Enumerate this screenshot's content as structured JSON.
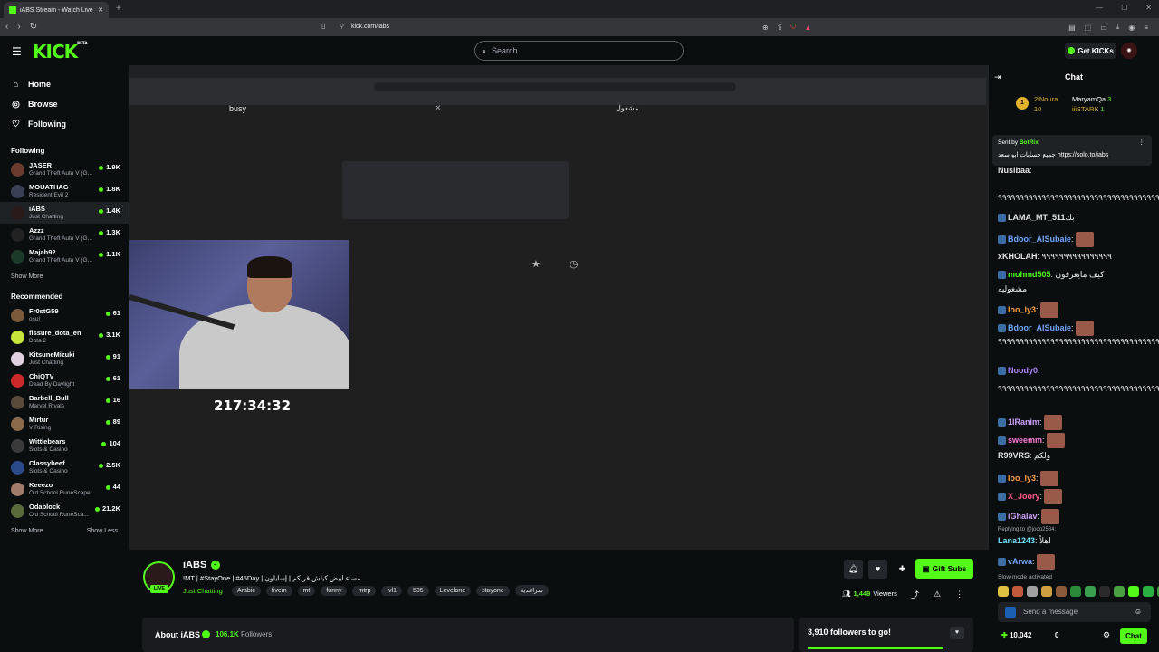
{
  "browser": {
    "tab_title": "iABS Stream - Watch Live on Kick",
    "new_tab": "+",
    "url": "kick.com/iabs"
  },
  "topnav": {
    "logo": "KICK",
    "logo_sup": "BETA",
    "search_placeholder": "Search",
    "get_kicks": "Get KICKs"
  },
  "sidebar": {
    "nav": [
      {
        "label": "Home",
        "icon": "home-icon"
      },
      {
        "label": "Browse",
        "icon": "compass-icon"
      },
      {
        "label": "Following",
        "icon": "heart-icon"
      }
    ],
    "following_title": "Following",
    "following": [
      {
        "name": "JASER",
        "category": "Grand Theft Auto V (G...",
        "viewers": "1.9K",
        "color": "#6b3b2f"
      },
      {
        "name": "MOUATHAG",
        "category": "Resident Evil 2",
        "viewers": "1.8K",
        "color": "#3a3f55"
      },
      {
        "name": "iABS",
        "category": "Just Chatting",
        "viewers": "1.4K",
        "color": "#2a1a1a"
      },
      {
        "name": "Azzz",
        "category": "Grand Theft Auto V (G...",
        "viewers": "1.3K",
        "color": "#222"
      },
      {
        "name": "Majah92",
        "category": "Grand Theft Auto V (G...",
        "viewers": "1.1K",
        "color": "#1b3a2a"
      }
    ],
    "show_more_1": "Show More",
    "recommended_title": "Recommended",
    "recommended": [
      {
        "name": "Fr0stG59",
        "category": "osu!",
        "viewers": "61",
        "color": "#7a5a3a"
      },
      {
        "name": "fissure_dota_en",
        "category": "Dota 2",
        "viewers": "3.1K",
        "color": "#c8e63a"
      },
      {
        "name": "KitsuneMizuki",
        "category": "Just Chatting",
        "viewers": "91",
        "color": "#e0d0e0"
      },
      {
        "name": "ChiQTV",
        "category": "Dead By Daylight",
        "viewers": "61",
        "color": "#cc2a2a"
      },
      {
        "name": "Barbell_Bull",
        "category": "Marvel Rivals",
        "viewers": "16",
        "color": "#5a4a3a"
      },
      {
        "name": "Mirtur",
        "category": "V Rising",
        "viewers": "89",
        "color": "#8a6a4a"
      },
      {
        "name": "Wittlebears",
        "category": "Slots & Casino",
        "viewers": "104",
        "color": "#3a3a3a"
      },
      {
        "name": "Classybeef",
        "category": "Slots & Casino",
        "viewers": "2.5K",
        "color": "#2a4a8a"
      },
      {
        "name": "Keeezo",
        "category": "Old School RuneScape",
        "viewers": "44",
        "color": "#a07a6a"
      },
      {
        "name": "Odablock",
        "category": "Old School RuneSca...",
        "viewers": "21.2K",
        "color": "#5a6a3a"
      }
    ],
    "show_more_2": "Show More",
    "show_less": "Show Less"
  },
  "video": {
    "busy_text": "busy",
    "output_text": "مشغول",
    "timer": "217:34:32"
  },
  "stream": {
    "name": "iABS",
    "live": "LIVE",
    "title": "!MT | #StayOne | #45Day | مساء ابيض كيلش قريكم | إسايلون",
    "category": "Just Chatting",
    "tags": [
      "Arabic",
      "fivem",
      "mt",
      "funny",
      "mtrp",
      "lvl1",
      "505",
      "Levelone",
      "stayone",
      "سراعدية"
    ],
    "gift_subs": "Gift Subs",
    "viewers_count": "1,449",
    "viewers_label": "Viewers",
    "about_title": "About iABS",
    "followers_count": "106.1K",
    "followers_label": "Followers",
    "goal_text": "3,910 followers to go!"
  },
  "chat": {
    "title": "Chat",
    "leaderboard": {
      "rank": "1",
      "first_name": "2iNoura",
      "first_count": "10",
      "second_name": "MaryamQa",
      "second_count": "3",
      "third_name": "iiiSTARK",
      "third_count": "1"
    },
    "pinned_sent_by": "Sent by",
    "pinned_user": "BotRix",
    "pinned_text": "جميع حسابات ابو سعد",
    "pinned_link": "https://solo.to/iabs",
    "messages": [
      {
        "user": "Nusibaa",
        "color": "#e5e5e5",
        "text": ":"
      },
      {
        "user": "",
        "color": "#efeff1",
        "text": "٩٩٩٩٩٩٩٩٩٩٩٩٩٩٩٩٩٩٩٩٩٩٩٩٩٩٩٩٩٩٩٩٩٩٩٩٩٩٩٩"
      },
      {
        "user": "LAMA_MT_511",
        "color": "#e5e5e5",
        "text": "بك :"
      },
      {
        "user": "Bdoor_AlSubaie",
        "color": "#6ea8ff",
        "text": ":"
      },
      {
        "user": "xKHOLAH",
        "color": "#e5e5e5",
        "text": ": ٩٩٩٩٩٩٩٩٩٩٩٩٩٩٩٩"
      },
      {
        "user": "mohmd505",
        "color": "#53fc18",
        "text": ": كيف مايعرفون"
      },
      {
        "user": "",
        "color": "#efeff1",
        "text": "مشغوليه"
      },
      {
        "user": "loo_ly3",
        "color": "#ff9f40",
        "text": ":"
      },
      {
        "user": "Bdoor_AlSubaie",
        "color": "#6ea8ff",
        "text": ":"
      },
      {
        "user": "",
        "color": "#efeff1",
        "text": "٩٩٩٩٩٩٩٩٩٩٩٩٩٩٩٩٩٩٩٩٩٩٩٩٩٩٩٩٩٩٩٩٩٩٩٩٩٩٩"
      },
      {
        "user": "Noody0",
        "color": "#b084ff",
        "text": ":"
      },
      {
        "user": "",
        "color": "#efeff1",
        "text": "٩٩٩٩٩٩٩٩٩٩٩٩٩٩٩٩٩٩٩٩٩٩٩٩٩٩٩٩٩٩٩٩٩٩٩٩٩٩٩"
      },
      {
        "user": "1lRanim",
        "color": "#d0a0ff",
        "text": ":"
      },
      {
        "user": "sweemm",
        "color": "#ff7ad9",
        "text": ":"
      },
      {
        "user": "R99VRS",
        "color": "#e5e5e5",
        "text": ": ولكم"
      },
      {
        "user": "loo_ly3",
        "color": "#ff9f40",
        "text": ":"
      },
      {
        "user": "X_Joory",
        "color": "#ff5a8a",
        "text": ":"
      },
      {
        "user": "iGhalav",
        "color": "#d0a0ff",
        "text": ":"
      },
      {
        "user": "Lana1243",
        "color": "#6ee0ff",
        "text": ": اهلاً"
      },
      {
        "user": "vArwa",
        "color": "#6ea8ff",
        "text": ":"
      }
    ],
    "replying": "Replying to @jooo2584:",
    "slow_mode": "Slow mode activated",
    "input_placeholder": "Send a message",
    "kicks_balance": "10,042",
    "zero": "0",
    "chat_button": "Chat"
  },
  "colors": {
    "accent": "#53fc18",
    "bg": "#0b0e0f",
    "panel": "#191b1f"
  }
}
